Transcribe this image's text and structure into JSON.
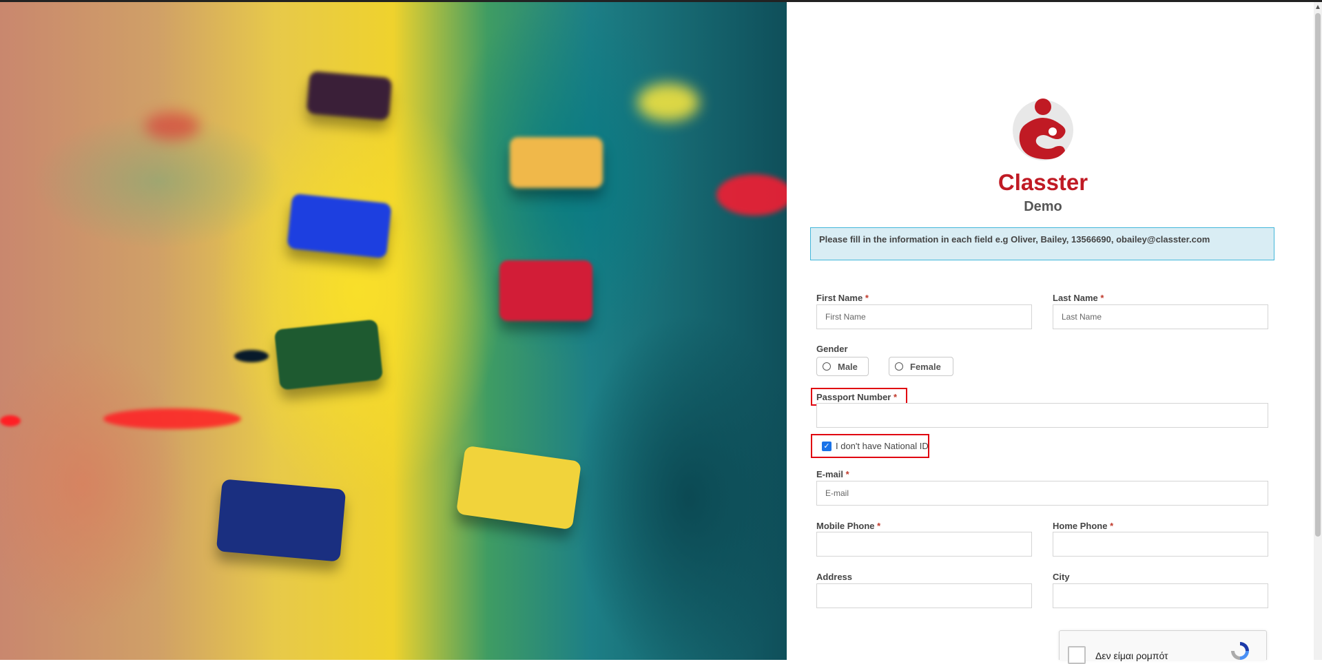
{
  "brand": {
    "name": "Classter",
    "subtitle": "Demo",
    "accent_color": "#c01a24"
  },
  "info_message": "Please fill in the information in each field e.g Oliver, Bailey, 13566690, obailey@classter.com",
  "form": {
    "required_mark": "*",
    "first_name": {
      "label": "First Name",
      "placeholder": "First Name"
    },
    "last_name": {
      "label": "Last Name",
      "placeholder": "Last Name"
    },
    "gender": {
      "label": "Gender",
      "options": [
        "Male",
        "Female"
      ]
    },
    "passport": {
      "label": "Passport Number",
      "value": ""
    },
    "no_national_id": {
      "label": "I don't have National ID",
      "checked": true
    },
    "email": {
      "label": "E-mail",
      "placeholder": "E-mail"
    },
    "mobile_phone": {
      "label": "Mobile Phone",
      "value": ""
    },
    "home_phone": {
      "label": "Home Phone",
      "value": ""
    },
    "address": {
      "label": "Address",
      "value": ""
    },
    "city": {
      "label": "City",
      "value": ""
    }
  },
  "recaptcha": {
    "label": "Δεν είμαι ρομπότ"
  },
  "highlight_color": "#e0000f",
  "icons": [
    "classter-logo-icon",
    "check-icon",
    "recaptcha-logo-icon",
    "chevron-up-icon"
  ]
}
